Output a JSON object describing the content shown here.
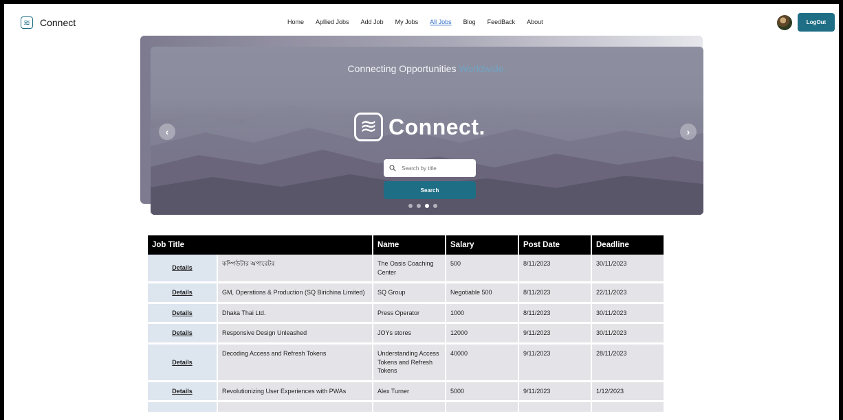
{
  "nav": {
    "brand": "Connect",
    "links": [
      "Home",
      "Apllied Jobs",
      "Add Job",
      "My Jobs",
      "All Jobs",
      "Blog",
      "FeedBack",
      "About"
    ],
    "active_link": "All Jobs",
    "logout_label": "LogOut"
  },
  "hero": {
    "tagline_main": "Connecting Opportunities",
    "tagline_highlight": "Worldwide.",
    "logo_word": "Connect.",
    "search_placeholder": "Search by title",
    "search_button": "Search",
    "slide_count": 4,
    "active_slide": 3
  },
  "colors": {
    "accent": "#1e6f86",
    "active_link": "#2d6bc4",
    "highlight": "#73a3c2"
  },
  "table": {
    "columns": [
      "Job Title",
      "",
      "Name",
      "Salary",
      "Post Date",
      "Deadline"
    ],
    "details_label": "Details",
    "rows": [
      {
        "title": "কম্পিউটার অপারেটর",
        "name": "The Oasis Coaching Center",
        "salary": "500",
        "post_date": "8/11/2023",
        "deadline": "30/11/2023"
      },
      {
        "title": "GM, Operations & Production (SQ Birichina Limited)",
        "name": "SQ Group",
        "salary": "Negotiable 500",
        "post_date": "8/11/2023",
        "deadline": "22/11/2023"
      },
      {
        "title": "Dhaka Thai Ltd.",
        "name": "Press Operator",
        "salary": "1000",
        "post_date": "8/11/2023",
        "deadline": "30/11/2023"
      },
      {
        "title": "Responsive Design Unleashed",
        "name": "JOYs stores",
        "salary": "12000",
        "post_date": "9/11/2023",
        "deadline": "30/11/2023"
      },
      {
        "title": "Decoding Access and Refresh Tokens",
        "name": "Understanding Access Tokens and Refresh Tokens",
        "salary": "40000",
        "post_date": "9/11/2023",
        "deadline": "28/11/2023"
      },
      {
        "title": "Revolutionizing User Experiences with PWAs",
        "name": "Alex Turner",
        "salary": "5000",
        "post_date": "9/11/2023",
        "deadline": "1/12/2023"
      }
    ]
  }
}
